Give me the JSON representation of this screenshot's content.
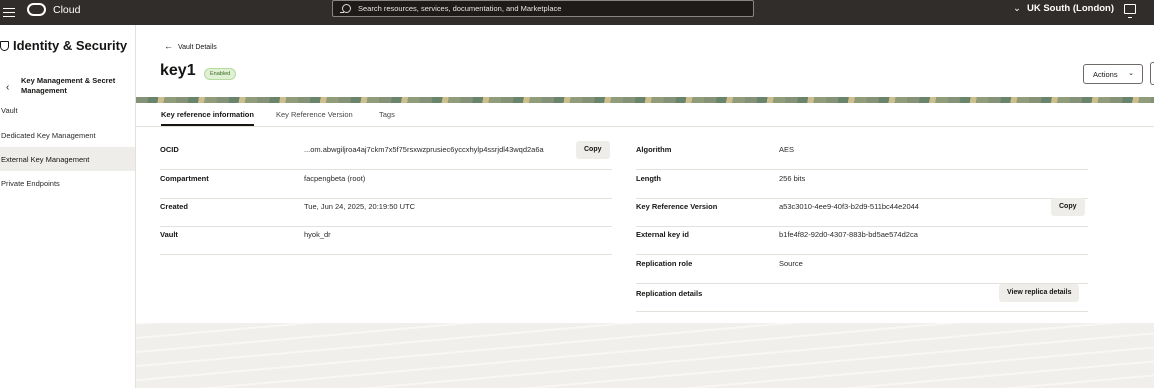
{
  "topbar": {
    "brand": "Cloud",
    "search_placeholder": "Search resources, services, documentation, and Marketplace",
    "region": "UK South (London)"
  },
  "sidebar": {
    "title": "Identity & Security",
    "parent": "Key Management & Secret Management",
    "items": [
      {
        "label": "Vault"
      },
      {
        "label": "Dedicated Key Management"
      },
      {
        "label": "External Key Management"
      },
      {
        "label": "Private Endpoints"
      }
    ]
  },
  "header": {
    "back_label": "Vault Details",
    "title": "key1",
    "status": "Enabled",
    "actions_label": "Actions"
  },
  "tabs": [
    {
      "label": "Key reference information"
    },
    {
      "label": "Key Reference Version"
    },
    {
      "label": "Tags"
    }
  ],
  "left_details": [
    {
      "label": "OCID",
      "value": "...om.abwgiljroa4aj7ckm7x5f75rsxwzprusiec6yccxhylp4ssrjdl43wqd2a6a",
      "button": "Copy"
    },
    {
      "label": "Compartment",
      "value": "facpengbeta (root)"
    },
    {
      "label": "Created",
      "value": "Tue, Jun 24, 2025, 20:19:50 UTC"
    },
    {
      "label": "Vault",
      "value": "hyok_dr"
    }
  ],
  "right_details": [
    {
      "label": "Algorithm",
      "value": "AES"
    },
    {
      "label": "Length",
      "value": "256 bits"
    },
    {
      "label": "Key Reference Version",
      "value": "a53c3010-4ee9-40f3-b2d9-511bc44e2044",
      "button": "Copy"
    },
    {
      "label": "External key id",
      "value": "b1fe4f82-92d0-4307-883b-bd5ae574d2ca"
    },
    {
      "label": "Replication role",
      "value": "Source"
    },
    {
      "label": "Replication details",
      "value": "",
      "button": "View replica details"
    }
  ]
}
